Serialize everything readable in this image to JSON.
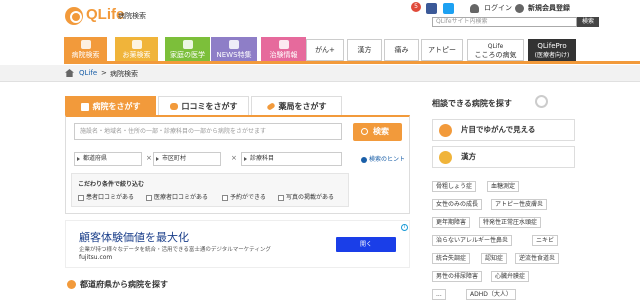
{
  "header": {
    "logo_text": "QLife",
    "subtitle": "病院検索",
    "login_label": "ログイン",
    "register_label": "新規会員登録",
    "notification_count": "5",
    "site_search": {
      "placeholder": "QLifeサイト内検索",
      "button_label": "検索"
    }
  },
  "nav": {
    "tabs": [
      {
        "label": "病院検索",
        "color": "#f29a3b"
      },
      {
        "label": "お薬検索",
        "color": "#f0b43a"
      },
      {
        "label": "家庭の医学",
        "color": "#7cbf3a"
      },
      {
        "label": "NEWS特集",
        "color": "#8e7ec7"
      },
      {
        "label": "治験情報",
        "color": "#e66a9c"
      }
    ],
    "links": [
      "がん+",
      "漢方",
      "痛み",
      "アトピー"
    ],
    "kokoro": {
      "top": "QLife",
      "bottom": "こころの病気"
    },
    "pro": {
      "top": "QLifePro",
      "bottom": "(医療者向け)"
    }
  },
  "breadcrumb": {
    "items": [
      "QLife",
      "病院検索"
    ]
  },
  "search": {
    "tabs": [
      {
        "label": "病院をさがす",
        "active": true
      },
      {
        "label": "口コミをさがす",
        "active": false
      },
      {
        "label": "薬局をさがす",
        "active": false
      }
    ],
    "keyword_placeholder": "施設名・地域名・住所の一部・診療科目の一部から病院をさがせます",
    "search_button": "検索",
    "selects": [
      "都道府県",
      "市区町村",
      "診療科目"
    ],
    "hint_label": "検索のヒント",
    "conditions": {
      "title": "こだわり条件で絞り込む",
      "options": [
        "患者口コミがある",
        "医療者口コミがある",
        "予約ができる",
        "写真の掲載がある"
      ]
    }
  },
  "ad": {
    "title": "顧客体験価値を最大化",
    "description": "企業が持つ様々なデータを統合・活用できる富士通のデジタルマーケティング",
    "url": "fujitsu.com",
    "button_label": "開く",
    "info_mark": "i"
  },
  "prefecture_heading": "都道府県から病院を探す",
  "sidebar": {
    "title": "相談できる病院を探す",
    "buttons": [
      "片目でゆがんで見える",
      "漢方"
    ],
    "tags": [
      [
        "骨粗しょう症",
        "血糖測定"
      ],
      [
        "女性のみの成長",
        "アトピー性皮膚炎"
      ],
      [
        "更年期障害",
        "特発性正常圧水頭症"
      ],
      [
        "治らないアレルギー性鼻炎",
        "ニキビ"
      ],
      [
        "統合失調症",
        "認知症",
        "逆流性食道炎"
      ],
      [
        "男性の排尿障害",
        "心臓弁膜症"
      ],
      [
        "...",
        "ADHD（大人）"
      ]
    ]
  },
  "colors": {
    "accent": "#f29a3b",
    "link": "#1a5fa8",
    "ad_button": "#1a3ee8"
  }
}
